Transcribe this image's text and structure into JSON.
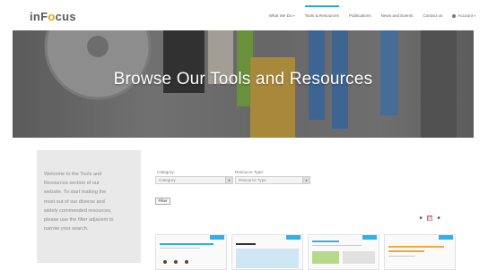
{
  "brand": {
    "logo_prefix": "inF",
    "logo_accent": "o",
    "logo_suffix": "cus"
  },
  "nav": {
    "items": [
      {
        "label": "What We Do",
        "chevron": true
      },
      {
        "label": "Tools & Resources",
        "active": true
      },
      {
        "label": "Publications"
      },
      {
        "label": "News and Events"
      },
      {
        "label": "Contact us"
      },
      {
        "label": "Account",
        "chevron": true,
        "icon": "account-icon"
      }
    ]
  },
  "hero": {
    "title": "Browse Our Tools and Resources"
  },
  "sidebar": {
    "lines": [
      "Welcome to the Tools and",
      "Resources section of our",
      "website. To start making the",
      "most out of our diverse and",
      "widely commended resources,",
      "please use the filter adjacent to",
      "narrow your search."
    ]
  },
  "filters": {
    "category_label": "Category:",
    "category_value": "Category",
    "resource_type_label": "Resource Type:",
    "resource_type_value": "Resource Type",
    "filter_button": "Filter"
  },
  "view_toggles": [
    "list-view",
    "grid-view",
    "tile-view"
  ],
  "colors": {
    "accent_blue": "#2aa7e0",
    "toggle_active": "#e88a9a"
  }
}
